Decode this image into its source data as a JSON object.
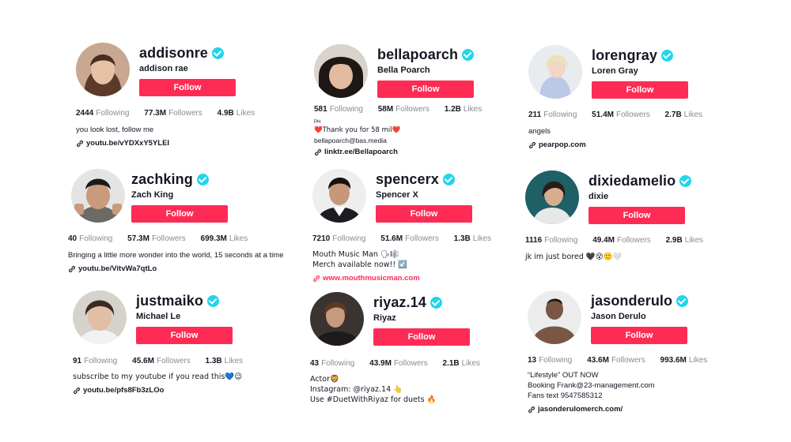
{
  "colors": {
    "follow": "#fe2c55",
    "verified": "#20d5ec",
    "muted": "#8a8b91"
  },
  "labels": {
    "following": "Following",
    "followers": "Followers",
    "likes": "Likes"
  },
  "profiles": [
    {
      "username": "addisonre",
      "display_name": "addison rae",
      "follow_label": "Follow",
      "following": "2444",
      "followers": "77.3M",
      "likes": "4.9B",
      "bio": [
        "you look lost, follow me"
      ],
      "link": "youtu.be/vYDXxY5YLEI"
    },
    {
      "username": "bellapoarch",
      "display_name": "Bella Poarch",
      "follow_label": "Follow",
      "following": "581",
      "followers": "58M",
      "likes": "1.2B",
      "bio_small": "PH",
      "bio": [
        "❤️Thank you for 58 mil❤️",
        "bellapoarch@bas.media"
      ],
      "link": "linktr.ee/Bellapoarch"
    },
    {
      "username": "lorengray",
      "display_name": "Loren Gray",
      "follow_label": "Follow",
      "following": "211",
      "followers": "51.4M",
      "likes": "2.7B",
      "bio": [
        "angels"
      ],
      "link": "pearpop.com"
    },
    {
      "username": "zachking",
      "display_name": "Zach King",
      "follow_label": "Follow",
      "following": "40",
      "followers": "57.3M",
      "likes": "699.3M",
      "bio": [
        "Bringing a little more wonder into the world, 15 seconds at a time"
      ],
      "link": "youtu.be/VitvWa7qtLo"
    },
    {
      "username": "spencerx",
      "display_name": "Spencer X",
      "follow_label": "Follow",
      "following": "7210",
      "followers": "51.6M",
      "likes": "1.3B",
      "bio": [
        "Mouth Music Man 🗣🎼",
        "Merch available now!! ↙️"
      ],
      "link": "www.mouthmusicman.com"
    },
    {
      "username": "dixiedamelio",
      "display_name": "dixie",
      "follow_label": "Follow",
      "following": "1116",
      "followers": "49.4M",
      "likes": "2.9B",
      "bio": [
        "jk im just bored 🖤😵🙂🤍"
      ]
    },
    {
      "username": "justmaiko",
      "display_name": "Michael Le",
      "follow_label": "Follow",
      "following": "91",
      "followers": "45.6M",
      "likes": "1.3B",
      "bio": [
        "subscribe to my youtube if you read this💙😉"
      ],
      "link": "youtu.be/pfs8Fb3zLOo"
    },
    {
      "username": "riyaz.14",
      "display_name": "Riyaz",
      "follow_label": "Follow",
      "following": "43",
      "followers": "43.9M",
      "likes": "2.1B",
      "bio": [
        "Actor🦁",
        "Instagram: @riyaz.14 👆",
        "Use #DuetWithRiyaz for duets 🔥"
      ]
    },
    {
      "username": "jasonderulo",
      "display_name": "Jason Derulo",
      "follow_label": "Follow",
      "following": "13",
      "followers": "43.6M",
      "likes": "993.6M",
      "bio": [
        "“Lifestyle” OUT NOW",
        "Booking Frank@23-management.com",
        "Fans text 9547585312"
      ],
      "link": "jasonderulomerch.com/"
    }
  ]
}
